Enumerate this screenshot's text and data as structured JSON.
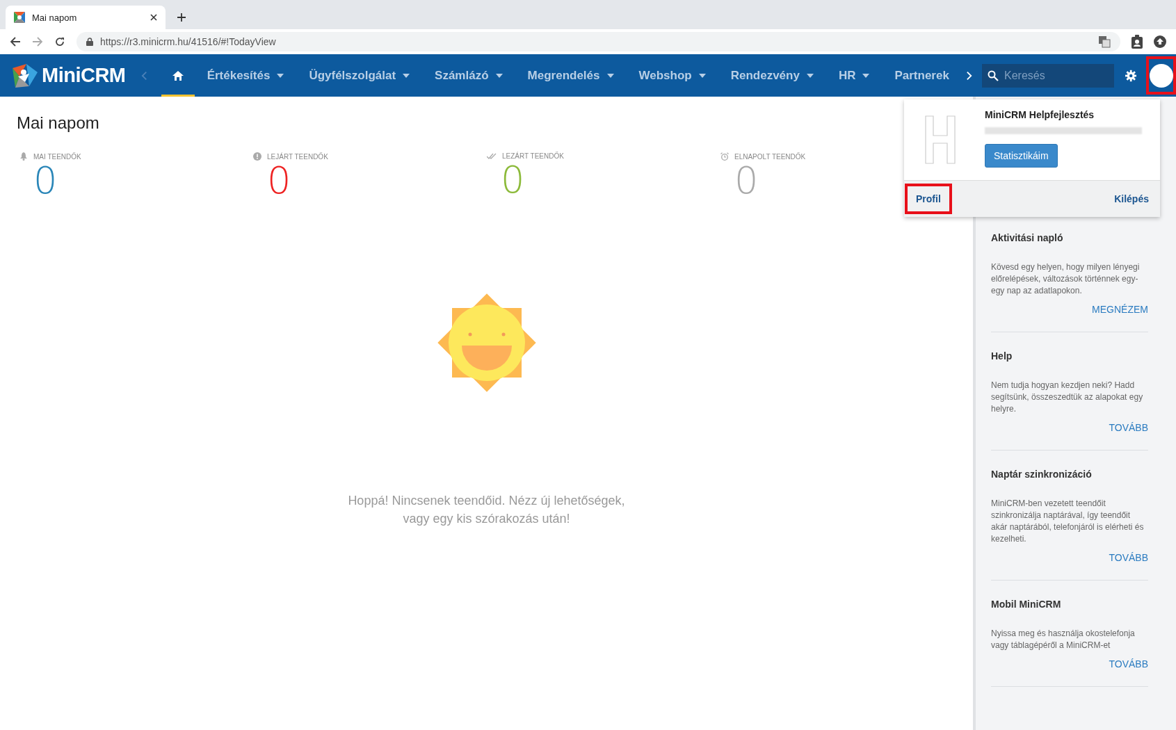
{
  "browser": {
    "tab": {
      "title": "Mai napom"
    },
    "url": "https://r3.minicrm.hu/41516/#!TodayView"
  },
  "app": {
    "logo": "MiniCRM",
    "nav": [
      {
        "kind": "home",
        "selected": true
      },
      {
        "label": "Értékesítés",
        "dropdown": true,
        "selected": false
      },
      {
        "label": "Ügyfélszolgálat",
        "dropdown": true,
        "selected": false
      },
      {
        "label": "Számlázó",
        "dropdown": true,
        "selected": false
      },
      {
        "label": "Megrendelés",
        "dropdown": true,
        "selected": false
      },
      {
        "label": "Webshop",
        "dropdown": true,
        "selected": false
      },
      {
        "label": "Rendezvény",
        "dropdown": true,
        "selected": false
      },
      {
        "label": "HR",
        "dropdown": true,
        "selected": false
      },
      {
        "label": "Partnerek",
        "dropdown": false,
        "selected": false
      }
    ],
    "search": {
      "placeholder": "Keresés"
    }
  },
  "page": {
    "title": "Mai napom",
    "stats": [
      {
        "kind": "bell",
        "label": "MAI TEENDŐK",
        "value": "0",
        "color": "#2a86b8"
      },
      {
        "kind": "alert",
        "label": "LEJÁRT TEENDŐK",
        "value": "0",
        "color": "#ee2222"
      },
      {
        "kind": "check",
        "label": "LEZÁRT TEENDŐK",
        "value": "0",
        "color": "#8cba3a"
      },
      {
        "kind": "alarm",
        "label": "ELNAPOLT TEENDŐK",
        "value": "0",
        "color": "#aaaaaa"
      }
    ],
    "empty_message": [
      "Hoppá! Nincsenek teendőid. Nézz új lehetőségek,",
      "vagy egy kis szórakozás után!"
    ]
  },
  "user_menu": {
    "name": "MiniCRM Helpfejlesztés",
    "stats_button": "Statisztikáim",
    "profile": "Profil",
    "logout": "Kilépés"
  },
  "sidebar": [
    {
      "title": "Aktivitási napló",
      "text": "Kövesd egy helyen, hogy milyen lényegi előrelépések, változások történnek egy-egy nap az adatlapokon.",
      "link": "MEGNÉZEM"
    },
    {
      "title": "Help",
      "text": "Nem tudja hogyan kezdjen neki? Hadd segítsünk, összeszedtük az alapokat egy helyre.",
      "link": "TOVÁBB"
    },
    {
      "title": "Naptár szinkronizáció",
      "text": "MiniCRM-ben vezetett teendőit szinkronizálja naptárával, így teendőit akár naptárából, telefonjáról is elérheti és kezelheti.",
      "link": "TOVÁBB"
    },
    {
      "title": "Mobil MiniCRM",
      "text": "Nyissa meg és használja okostelefonja vagy táblagépéről a MiniCRM-et",
      "link": "TOVÁBB"
    }
  ]
}
